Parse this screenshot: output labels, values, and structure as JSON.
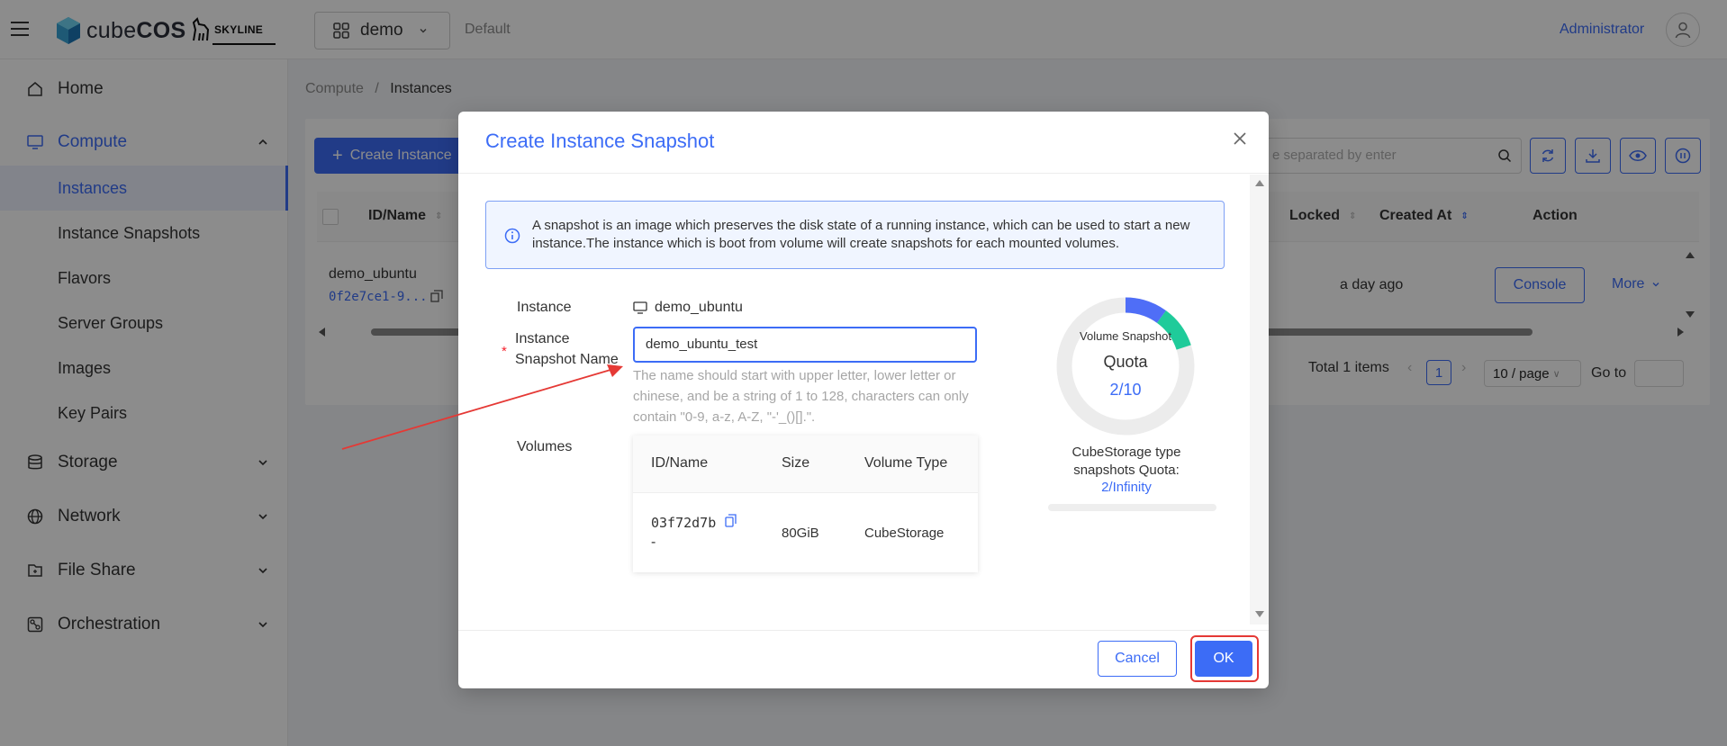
{
  "header": {
    "logo_text_light": "cube",
    "logo_text_bold": "COS",
    "skyline_text": "SKYLINE",
    "project": "demo",
    "domain": "Default",
    "user": "Administrator"
  },
  "sidebar": {
    "items": [
      {
        "label": "Home",
        "icon": "home-icon"
      },
      {
        "label": "Compute",
        "icon": "monitor-icon",
        "expanded": true
      },
      {
        "label": "Storage",
        "icon": "database-icon"
      },
      {
        "label": "Network",
        "icon": "globe-icon"
      },
      {
        "label": "File Share",
        "icon": "folder-icon"
      },
      {
        "label": "Orchestration",
        "icon": "orchestration-icon"
      }
    ],
    "compute_children": [
      "Instances",
      "Instance Snapshots",
      "Flavors",
      "Server Groups",
      "Images",
      "Key Pairs"
    ],
    "active": "Instances"
  },
  "breadcrumb": {
    "parent": "Compute",
    "separator": "/",
    "current": "Instances"
  },
  "toolbar": {
    "create_label": "Create Instance",
    "search_placeholder": "e separated by enter"
  },
  "table": {
    "columns": [
      "ID/Name",
      "Locked",
      "Created At",
      "Action"
    ],
    "rows": [
      {
        "name": "demo_ubuntu",
        "id": "0f2e7ce1-9...",
        "created": "a day ago",
        "console": "Console",
        "more": "More"
      }
    ]
  },
  "pagination": {
    "total": "Total 1 items",
    "page": "1",
    "page_size": "10 / page",
    "goto": "Go to"
  },
  "modal": {
    "title": "Create Instance Snapshot",
    "info": "A snapshot is an image which preserves the disk state of a running instance, which can be used to start a new instance.The instance which is boot from volume will create snapshots for each mounted volumes.",
    "instance_label": "Instance",
    "instance_value": "demo_ubuntu",
    "name_label_line1": "Instance",
    "name_label_line2": "Snapshot Name",
    "required_mark": "*",
    "name_value": "demo_ubuntu_test",
    "name_hint": "The name should start with upper letter, lower letter or chinese, and be a string of 1 to 128, characters can only contain \"0-9, a-z, A-Z, \"-'_()[].\".",
    "volumes_label": "Volumes",
    "volume_columns": [
      "ID/Name",
      "Size",
      "Volume Type"
    ],
    "volume_rows": [
      {
        "id": "03f72d7b",
        "name": "-",
        "size": "80GiB",
        "type": "CubeStorage"
      }
    ],
    "quota": {
      "caption": "Volume Snapshot",
      "title": "Quota",
      "value": "2/10",
      "used": 2,
      "limit": 10,
      "used_color": "#4f6ef7",
      "extra_color": "#1fcb9a",
      "type_label": "CubeStorage type snapshots Quota:",
      "type_value": "2/Infinity"
    },
    "cancel_label": "Cancel",
    "ok_label": "OK"
  },
  "colors": {
    "primary": "#3c6cf6",
    "annotation": "#e53935"
  }
}
